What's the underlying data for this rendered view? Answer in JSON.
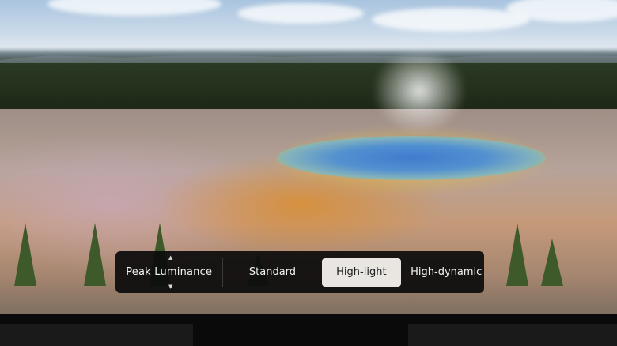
{
  "picture_mode_menu": {
    "setting_label": "Peak Luminance",
    "up_icon": "triangle-up",
    "down_icon": "triangle-down",
    "options": [
      {
        "label": "Standard",
        "selected": false
      },
      {
        "label": "High-light",
        "selected": true
      },
      {
        "label": "High-dynamic",
        "selected": false
      }
    ],
    "selected_color": "#e9e6e2"
  }
}
